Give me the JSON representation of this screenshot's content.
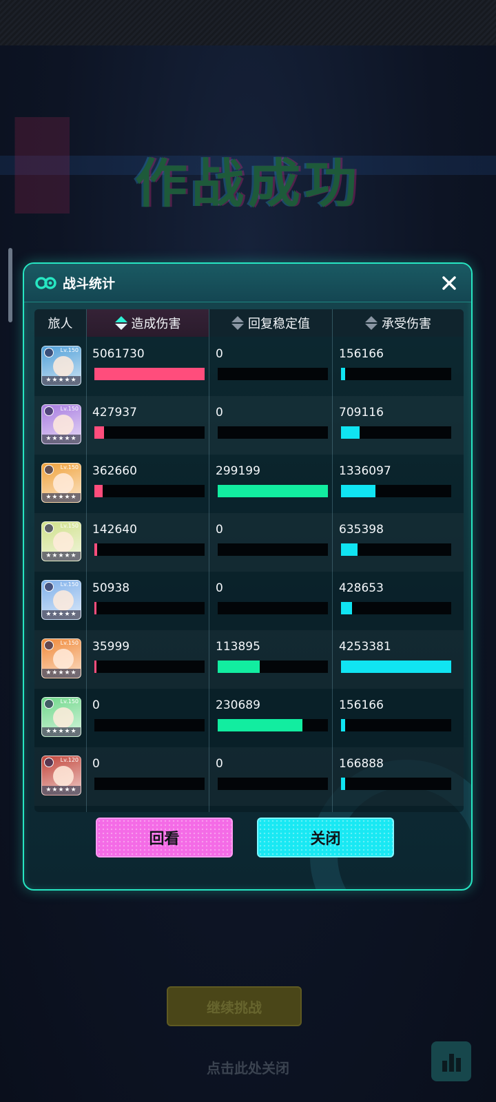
{
  "background": {
    "title": "作战成功",
    "continue_label": "继续挑战",
    "tap_to_close": "点击此处关闭"
  },
  "dialog": {
    "title": "战斗统计",
    "close_icon": "close-icon",
    "columns": {
      "traveler": "旅人",
      "damage_dealt": "造成伤害",
      "stability_restored": "回复稳定值",
      "damage_taken": "承受伤害"
    },
    "sort_column": "damage_dealt",
    "rows": [
      {
        "level": "Lv.150",
        "damage_dealt": "5061730",
        "stability_restored": "0",
        "damage_taken": "156166",
        "bars": [
          1.0,
          0,
          0.037
        ],
        "avatar_color": "#4f9fd8"
      },
      {
        "level": "Lv.150",
        "damage_dealt": "427937",
        "stability_restored": "0",
        "damage_taken": "709116",
        "bars": [
          0.085,
          0,
          0.167
        ],
        "avatar_color": "#a77be0"
      },
      {
        "level": "Lv.150",
        "damage_dealt": "362660",
        "stability_restored": "299199",
        "damage_taken": "1336097",
        "bars": [
          0.072,
          1.0,
          0.314
        ],
        "avatar_color": "#f0a23c"
      },
      {
        "level": "Lv.150",
        "damage_dealt": "142640",
        "stability_restored": "0",
        "damage_taken": "635398",
        "bars": [
          0.028,
          0,
          0.149
        ],
        "avatar_color": "#cfe08a"
      },
      {
        "level": "Lv.150",
        "damage_dealt": "50938",
        "stability_restored": "0",
        "damage_taken": "428653",
        "bars": [
          0.01,
          0,
          0.101
        ],
        "avatar_color": "#7fb0ea"
      },
      {
        "level": "Lv.150",
        "damage_dealt": "35999",
        "stability_restored": "113895",
        "damage_taken": "4253381",
        "bars": [
          0.007,
          0.381,
          1.0
        ],
        "avatar_color": "#f08a3a"
      },
      {
        "level": "Lv.150",
        "damage_dealt": "0",
        "stability_restored": "230689",
        "damage_taken": "156166",
        "bars": [
          0,
          0.771,
          0.037
        ],
        "avatar_color": "#6fd88a"
      },
      {
        "level": "Lv.120",
        "damage_dealt": "0",
        "stability_restored": "0",
        "damage_taken": "166888",
        "bars": [
          0,
          0,
          0.039
        ],
        "avatar_color": "#c2453a"
      }
    ],
    "colors": {
      "damage_dealt": "#ff4d7c",
      "stability_restored": "#12eda0",
      "damage_taken": "#10e4f2",
      "accent": "#27e6c2"
    },
    "replay_label": "回看",
    "close_label": "关闭"
  }
}
